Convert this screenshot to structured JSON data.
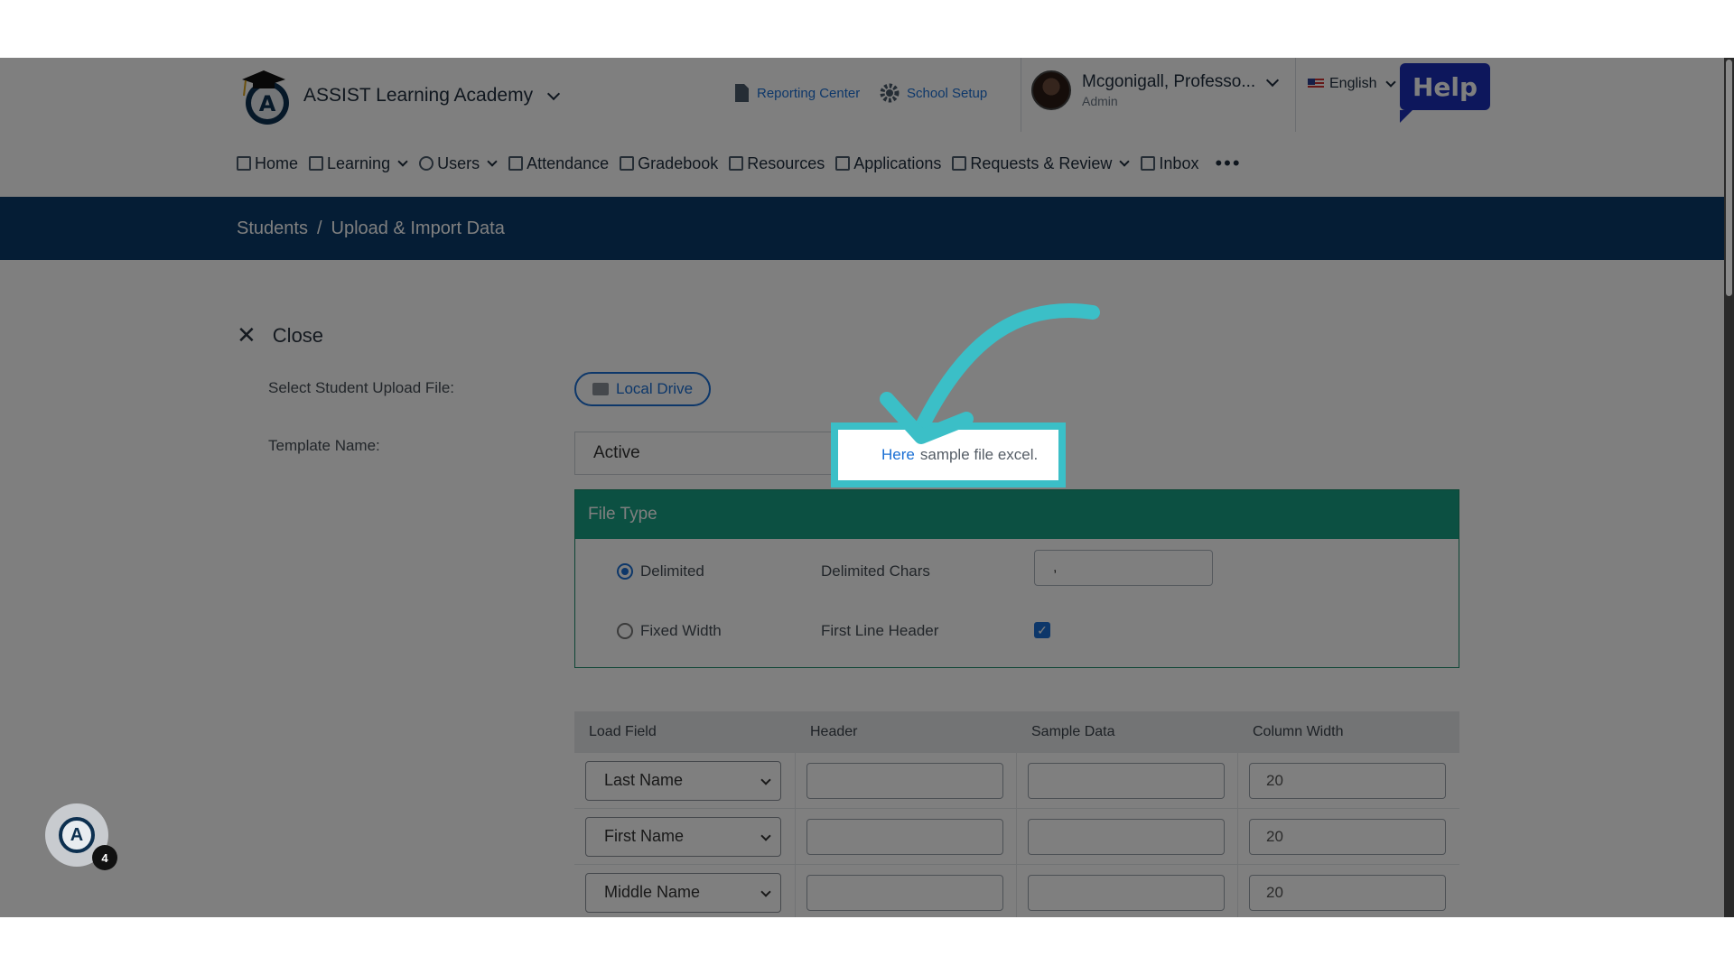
{
  "header": {
    "app_title": "ASSIST Learning Academy",
    "reporting_center": "Reporting Center",
    "school_setup": "School Setup",
    "user_name": "Mcgonigall, Professo...",
    "user_role": "Admin",
    "language": "English",
    "help_label": "Help"
  },
  "nav": {
    "items": [
      {
        "label": "Home",
        "icon": "home-icon"
      },
      {
        "label": "Learning",
        "icon": "book-icon",
        "dropdown": true
      },
      {
        "label": "Users",
        "icon": "user-icon",
        "dropdown": true
      },
      {
        "label": "Attendance",
        "icon": "list-icon"
      },
      {
        "label": "Gradebook",
        "icon": "gradebook-icon"
      },
      {
        "label": "Resources",
        "icon": "resources-icon"
      },
      {
        "label": "Applications",
        "icon": "chat-icon"
      },
      {
        "label": "Requests & Review",
        "icon": "document-icon",
        "dropdown": true
      },
      {
        "label": "Inbox",
        "icon": "mail-icon"
      }
    ],
    "more_label": "•••"
  },
  "breadcrumb": {
    "items": [
      "Students",
      "Upload & Import Data"
    ],
    "separator": "/"
  },
  "form": {
    "close_label": "Close",
    "select_file_label": "Select Student Upload File:",
    "local_drive_label": "Local Drive",
    "template_label": "Template Name:",
    "template_value": "Active",
    "tooltip_link": "Here",
    "tooltip_text": "sample file excel."
  },
  "file_type": {
    "title": "File Type",
    "delimited_label": "Delimited",
    "fixed_width_label": "Fixed Width",
    "delimited_chars_label": "Delimited Chars",
    "delimited_chars_value": ",",
    "first_line_header_label": "First Line Header",
    "first_line_header_checked": true,
    "selected": "Delimited"
  },
  "mapping": {
    "columns": [
      "Load Field",
      "Header",
      "Sample Data",
      "Column Width"
    ],
    "rows": [
      {
        "load_field": "Last Name",
        "header": "",
        "sample": "",
        "width": "20"
      },
      {
        "load_field": "First Name",
        "header": "",
        "sample": "",
        "width": "20"
      },
      {
        "load_field": "Middle Name",
        "header": "",
        "sample": "",
        "width": "20"
      }
    ]
  },
  "badge": {
    "count": "4"
  },
  "colors": {
    "accent": "#1a6fd4",
    "header_band": "#0a3a6a",
    "file_type_header": "#19a184",
    "highlight": "#3bbfc7",
    "help_button": "#1a2fb8"
  }
}
